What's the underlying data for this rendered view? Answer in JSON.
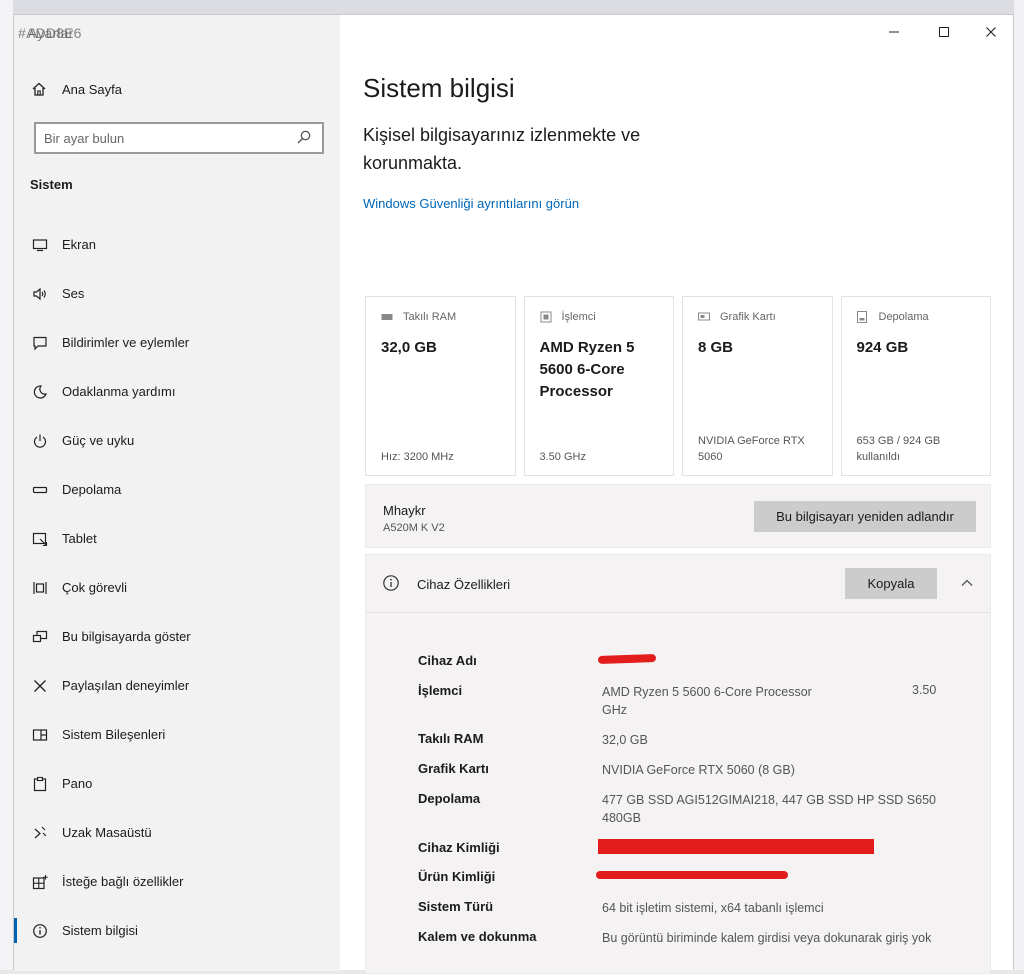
{
  "window": {
    "title": "Ayarlar",
    "overlay_tag": "#ADD8E6"
  },
  "window_controls": {
    "minimize": "—",
    "maximize": "☐",
    "close": "✕"
  },
  "sidebar": {
    "home_label": "Ana Sayfa",
    "search_placeholder": "Bir ayar bulun",
    "section": "Sistem",
    "items": [
      {
        "label": "Ekran",
        "icon": "monitor-icon"
      },
      {
        "label": "Ses",
        "icon": "speaker-icon"
      },
      {
        "label": "Bildirimler ve eylemler",
        "icon": "notification-icon"
      },
      {
        "label": "Odaklanma yardımı",
        "icon": "moon-icon"
      },
      {
        "label": "Güç ve uyku",
        "icon": "power-icon"
      },
      {
        "label": "Depolama",
        "icon": "storage-icon"
      },
      {
        "label": "Tablet",
        "icon": "tablet-icon"
      },
      {
        "label": "Çok görevli",
        "icon": "multitask-icon"
      },
      {
        "label": "Bu bilgisayarda göster",
        "icon": "project-icon"
      },
      {
        "label": "Paylaşılan deneyimler",
        "icon": "shared-icon"
      },
      {
        "label": "Sistem Bileşenleri",
        "icon": "components-icon"
      },
      {
        "label": "Pano",
        "icon": "clipboard-icon"
      },
      {
        "label": "Uzak Masaüstü",
        "icon": "remote-icon"
      },
      {
        "label": "İsteğe bağlı özellikler",
        "icon": "optional-features-icon"
      },
      {
        "label": "Sistem bilgisi",
        "icon": "info-icon",
        "active": true
      }
    ]
  },
  "main": {
    "title": "Sistem bilgisi",
    "protection_text": "Kişisel bilgisayarınız izlenmekte ve korunmakta.",
    "security_link": "Windows Güvenliği ayrıntılarını görün",
    "cards": [
      {
        "label": "Takılı RAM",
        "value": "32,0 GB",
        "foot": "Hız: 3200 MHz"
      },
      {
        "label": "İşlemci",
        "value": "AMD Ryzen 5 5600 6-Core Processor",
        "foot": "3.50 GHz"
      },
      {
        "label": "Grafik Kartı",
        "value": "8 GB",
        "foot": "NVIDIA GeForce RTX 5060"
      },
      {
        "label": "Depolama",
        "value": "924 GB",
        "foot": "653 GB / 924 GB kullanıldı"
      }
    ],
    "pc": {
      "name": "Mhaykr",
      "board": "A520M K V2",
      "rename_button": "Bu bilgisayarı yeniden adlandır"
    },
    "device": {
      "title": "Cihaz Özellikleri",
      "copy_button": "Kopyala",
      "specs": {
        "device_name_label": "Cihaz Adı",
        "processor_label": "İşlemci",
        "processor_value": "AMD Ryzen 5 5600 6-Core Processor",
        "processor_speed": "3.50",
        "processor_unit": "GHz",
        "ram_label": "Takılı RAM",
        "ram_value": "32,0 GB",
        "gpu_label": "Grafik Kartı",
        "gpu_value": "NVIDIA GeForce RTX 5060 (8 GB)",
        "storage_label": "Depolama",
        "storage_value": "477 GB SSD AGI512GIMAI218, 447 GB SSD HP SSD S650 480GB",
        "device_id_label": "Cihaz Kimliği",
        "product_id_label": "Ürün Kimliği",
        "system_type_label": "Sistem Türü",
        "system_type_value": "64 bit işletim sistemi, x64 tabanlı işlemci",
        "pen_label": "Kalem ve dokunma",
        "pen_value": "Bu görüntü biriminde kalem girdisi veya dokunarak giriş yok"
      }
    }
  },
  "colors": {
    "accent": "#0063b1",
    "link": "#0067b8",
    "redaction": "#e31c1c",
    "sidebar_bg": "#f2f2f2",
    "panel_bg": "#f4f2f3"
  }
}
